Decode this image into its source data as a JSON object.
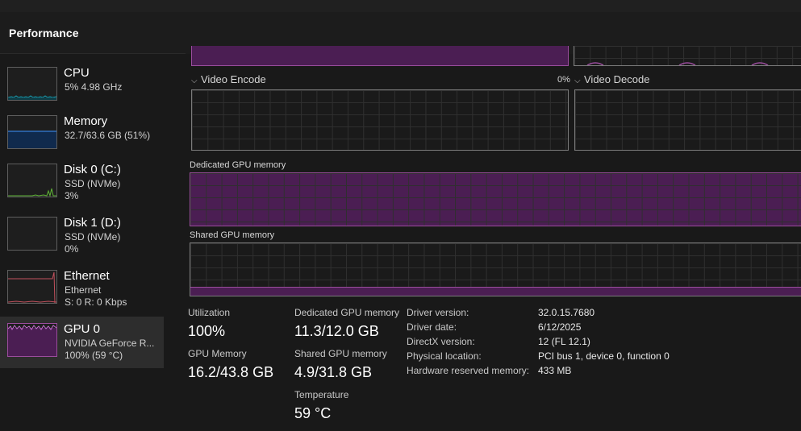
{
  "header": {
    "title": "Performance"
  },
  "sidebar": {
    "items": [
      {
        "name": "CPU",
        "line1": "5% 4.98 GHz",
        "line2": ""
      },
      {
        "name": "Memory",
        "line1": "32.7/63.6 GB (51%)",
        "line2": ""
      },
      {
        "name": "Disk 0 (C:)",
        "line1": "SSD (NVMe)",
        "line2": "3%"
      },
      {
        "name": "Disk 1 (D:)",
        "line1": "SSD (NVMe)",
        "line2": "0%"
      },
      {
        "name": "Ethernet",
        "line1": "Ethernet",
        "line2": "S: 0  R: 0 Kbps"
      },
      {
        "name": "GPU 0",
        "line1": "NVIDIA GeForce R...",
        "line2": "100%  (59 °C)"
      }
    ]
  },
  "graphs": {
    "video_encode": {
      "label": "Video Encode",
      "percent": "0%"
    },
    "video_decode": {
      "label": "Video Decode"
    },
    "dedicated_memory": {
      "label": "Dedicated GPU memory"
    },
    "shared_memory": {
      "label": "Shared GPU memory"
    }
  },
  "stats": {
    "utilization": {
      "label": "Utilization",
      "value": "100%"
    },
    "gpu_memory": {
      "label": "GPU Memory",
      "value": "16.2/43.8 GB"
    },
    "dedicated": {
      "label": "Dedicated GPU memory",
      "value": "11.3/12.0 GB"
    },
    "shared": {
      "label": "Shared GPU memory",
      "value": "4.9/31.8 GB"
    },
    "temperature": {
      "label": "Temperature",
      "value": "59 °C"
    }
  },
  "details": [
    {
      "key": "Driver version:",
      "value": "32.0.15.7680"
    },
    {
      "key": "Driver date:",
      "value": "6/12/2025"
    },
    {
      "key": "DirectX version:",
      "value": "12 (FL 12.1)"
    },
    {
      "key": "Physical location:",
      "value": "PCI bus 1, device 0, function 0"
    },
    {
      "key": "Hardware reserved memory:",
      "value": "433 MB"
    }
  ],
  "colors": {
    "cpu": "#17a3b8",
    "memory": "#2f6fbf",
    "disk": "#5fb336",
    "ethernet": "#c2515d",
    "gpu": "#9b4d9e"
  }
}
